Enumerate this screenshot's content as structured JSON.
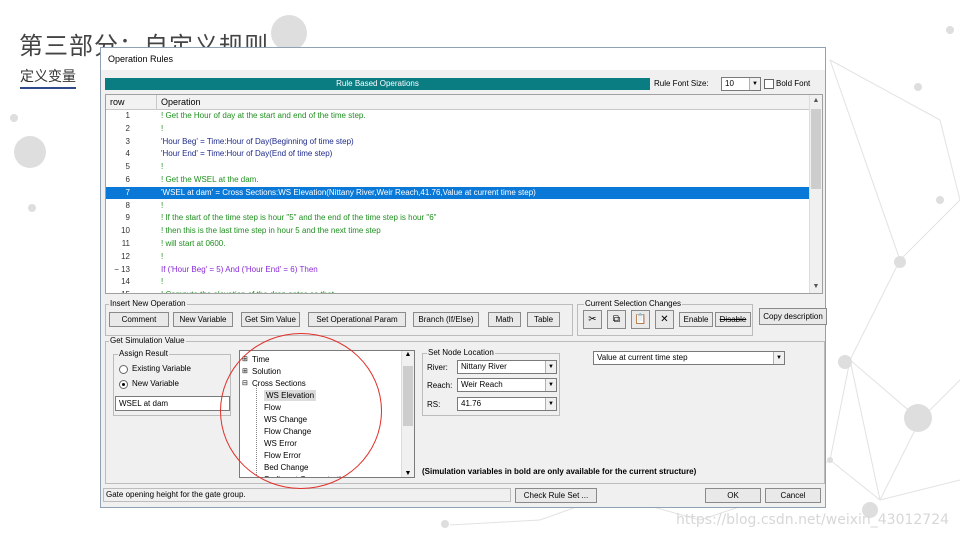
{
  "slide": {
    "title": "第三部分：自定义规则",
    "subtitle": "定义变量",
    "watermark": "https://blog.csdn.net/weixin_43012724"
  },
  "window": {
    "title": "Operation Rules"
  },
  "header": {
    "banner": "Rule Based Operations",
    "font_size_label": "Rule Font Size:",
    "font_size_value": "10",
    "bold_font_label": "Bold Font",
    "bold_font_checked": false
  },
  "grid": {
    "columns": [
      "row",
      "Operation"
    ],
    "selected_row": "7",
    "rows": [
      {
        "n": "1",
        "text": "!  Get the Hour of day at the start and end of the time step.",
        "kind": "comment"
      },
      {
        "n": "2",
        "text": "!",
        "kind": "comment"
      },
      {
        "n": "3",
        "text": "'Hour Beg' = Time:Hour of Day(Beginning of time step)",
        "kind": "assign"
      },
      {
        "n": "4",
        "text": "'Hour End' = Time:Hour of Day(End of time step)",
        "kind": "assign"
      },
      {
        "n": "5",
        "text": "!",
        "kind": "comment"
      },
      {
        "n": "6",
        "text": "!  Get the WSEL at the dam.",
        "kind": "comment"
      },
      {
        "n": "7",
        "text": "'WSEL at dam' = Cross Sections:WS Elevation(Nittany River,Weir Reach,41.76,Value at current time step)",
        "kind": "assign"
      },
      {
        "n": "8",
        "text": "!",
        "kind": "comment"
      },
      {
        "n": "9",
        "text": "!  If the start of the time step is hour \"5\" and the end of the time step is hour \"6\"",
        "kind": "comment"
      },
      {
        "n": "10",
        "text": "!  then this is the last time step in hour 5 and the next time step",
        "kind": "comment"
      },
      {
        "n": "11",
        "text": "!  will start at 0600.",
        "kind": "comment"
      },
      {
        "n": "12",
        "text": "!",
        "kind": "comment"
      },
      {
        "n": "− 13",
        "text": "If ('Hour Beg' = 5) And ('Hour End' = 6) Then",
        "kind": "keyword"
      },
      {
        "n": "14",
        "text": "      !",
        "kind": "comment"
      },
      {
        "n": "15",
        "text": "      !  Compute the elevation of the drop gates so that",
        "kind": "comment"
      }
    ]
  },
  "insert_operation": {
    "label": "Insert New Operation",
    "buttons": [
      "Comment",
      "New Variable",
      "Get Sim Value",
      "Set Operational Param",
      "Branch (If/Else)",
      "Math",
      "Table"
    ]
  },
  "selection_changes": {
    "label": "Current Selection Changes",
    "icons": [
      "cut-icon",
      "copy-icon",
      "paste-icon",
      "delete-icon"
    ],
    "enable_label": "Enable",
    "disable_label": "Disable"
  },
  "copy_description_label": "Copy description",
  "get_sim_value": {
    "label": "Get Simulation Value",
    "assign_result": {
      "label": "Assign Result",
      "existing_variable": "Existing Variable",
      "new_variable": "New Variable",
      "selected": "new",
      "variable_name": "WSEL at dam"
    },
    "tree": {
      "items": [
        {
          "text": "Time",
          "level": 0,
          "expander": "+"
        },
        {
          "text": "Solution",
          "level": 0,
          "expander": "+"
        },
        {
          "text": "Cross Sections",
          "level": 0,
          "expander": "−"
        },
        {
          "text": "WS Elevation",
          "level": 1,
          "selected": true
        },
        {
          "text": "Flow",
          "level": 1
        },
        {
          "text": "WS Change",
          "level": 1
        },
        {
          "text": "Flow Change",
          "level": 1
        },
        {
          "text": "WS Error",
          "level": 1
        },
        {
          "text": "Flow Error",
          "level": 1
        },
        {
          "text": "Bed Change",
          "level": 1
        },
        {
          "text": "Sediment Concentration",
          "level": 1
        }
      ]
    },
    "node_location": {
      "label": "Set Node Location",
      "river_label": "River:",
      "river_value": "Nittany River",
      "reach_label": "Reach:",
      "reach_value": "Weir Reach",
      "rs_label": "RS:",
      "rs_value": "41.76"
    },
    "value_type": "Value at current time step",
    "note": "(Simulation variables in bold are only available for the current structure)"
  },
  "footer": {
    "status_text": "Gate opening height for the gate group.",
    "check_rule_set": "Check Rule Set ...",
    "ok": "OK",
    "cancel": "Cancel"
  },
  "colors": {
    "banner": "#0a7d83",
    "selection": "#0a78d7",
    "comment": "#1f8f1f",
    "assign": "#1e2a8a",
    "keyword": "#8a2bd6",
    "highlight_circle": "#e0302a"
  }
}
